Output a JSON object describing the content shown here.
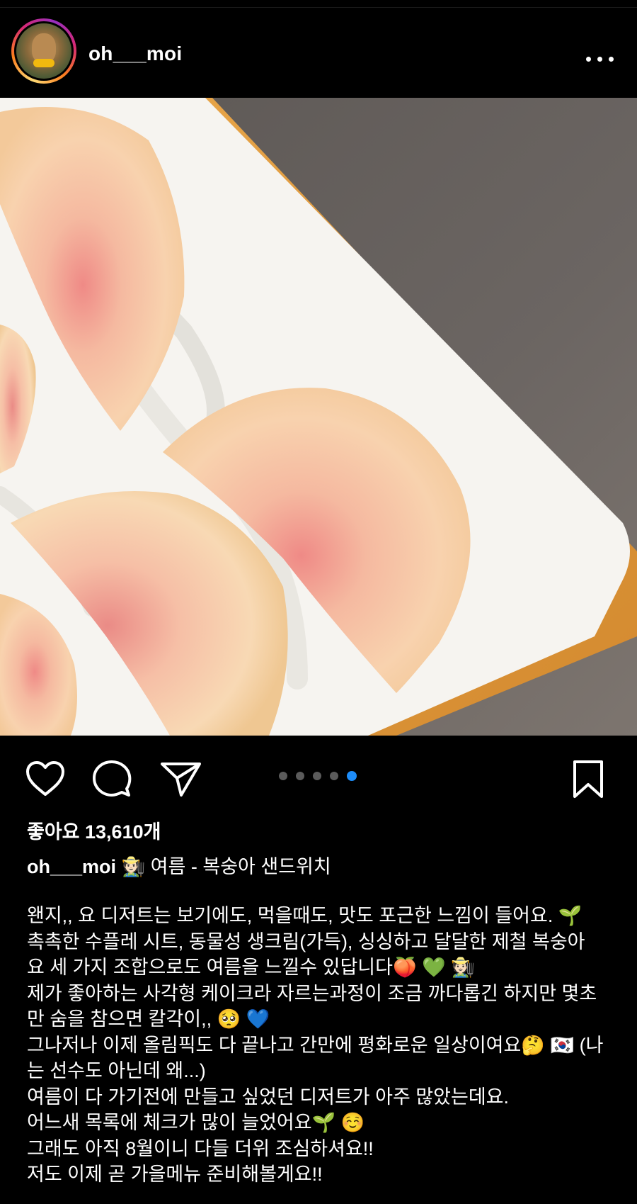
{
  "post": {
    "username": "oh___moi",
    "more_icon": "more-horizontal-icon",
    "likes_text": "좋아요 13,610개",
    "caption_user": "oh___moi",
    "caption_title": "🧑🏻‍🌾 여름 - 복숭아 샌드위치",
    "caption_lines": [
      "왠지,, 요 디저트는 보기에도, 먹을때도, 맛도 포근한 느낌이 들어요. 🌱",
      "촉촉한 수플레 시트, 동물성 생크림(가득), 싱싱하고 달달한 제철 복숭아",
      "요 세 가지 조합으로도 여름을 느낄수 있답니다🍑 💚 🧑🏻‍🌾",
      "제가 좋아하는 사각형 케이크라 자르는과정이 조금 까다롭긴 하지만 몇초",
      "만 숨을 참으면 칼각이,, 🥺 💙",
      "그나저나 이제 올림픽도 다 끝나고 간만에 평화로운 일상이여요🤔 🇰🇷 (나",
      "는 선수도 아닌데 왜...)",
      "여름이 다 가기전에 만들고 싶었던 디저트가 아주 많았는데요.",
      "어느새 목록에 체크가 많이 늘었어요🌱 ☺️",
      "그래도 아직 8월이니 다들 더위 조심하셔요!!",
      "저도 이제 곧 가을메뉴 준비해볼게요!!"
    ]
  },
  "carousel": {
    "count": 5,
    "active_index": 4
  },
  "icons": {
    "like": "heart-icon",
    "comment": "comment-icon",
    "share": "send-icon",
    "save": "bookmark-icon"
  },
  "colors": {
    "background": "#000000",
    "active_dot": "#1d8cf8",
    "inactive_dot": "#5b5b5b"
  }
}
